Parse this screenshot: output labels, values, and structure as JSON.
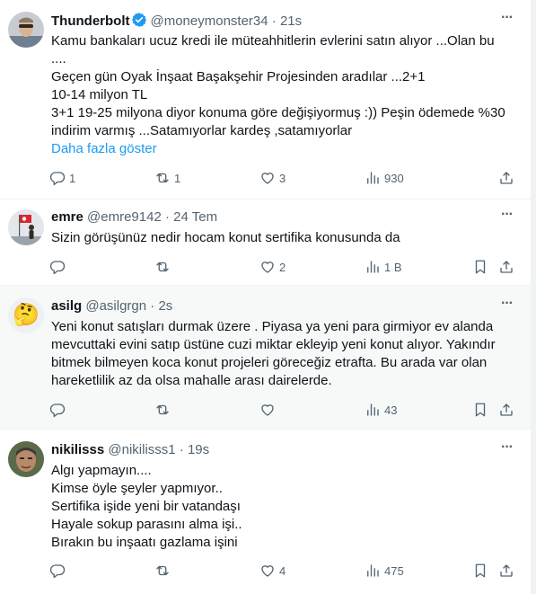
{
  "tweets": [
    {
      "name": "Thunderbolt",
      "handle": "@moneymonster34",
      "dot": "·",
      "time": "21s",
      "lines": [
        "Kamu bankaları ucuz kredi ile müteahhitlerin evlerini satın alıyor ...Olan bu",
        "....",
        "Geçen gün Oyak İnşaat Başakşehir Projesinden aradılar ...2+1",
        "10-14 milyon TL",
        "3+1 19-25 milyona diyor konuma göre değişiyormuş :)) Peşin ödemede %30",
        "indirim varmış ...Satamıyorlar kardeş ,satamıyorlar"
      ],
      "show_more": "Daha fazla göster",
      "replies": "1",
      "retweets": "1",
      "likes": "3",
      "views": "930"
    },
    {
      "name": "emre",
      "handle": "@emre9142",
      "dot": "·",
      "time": "24 Tem",
      "lines": [
        "Sizin görüşünüz nedir hocam konut sertifika konusunda da"
      ],
      "replies": "",
      "retweets": "",
      "likes": "2",
      "views": "1 B"
    },
    {
      "name": "asilg",
      "handle": "@asilgrgn",
      "dot": "·",
      "time": "2s",
      "lines": [
        "Yeni konut satışları durmak üzere . Piyasa ya yeni para girmiyor ev alanda",
        "mevcuttaki evini satıp üstüne cuzi miktar ekleyip yeni konut alıyor. Yakındır",
        "bitmek bilmeyen koca konut projeleri göreceğiz etrafta. Bu arada var olan",
        "hareketlilik az da olsa mahalle arası dairelerde."
      ],
      "replies": "",
      "retweets": "",
      "likes": "",
      "views": "43"
    },
    {
      "name": "nikilisss",
      "handle": "@nikilisss1",
      "dot": "·",
      "time": "19s",
      "lines": [
        "Algı yapmayın....",
        "Kimse öyle şeyler yapmıyor..",
        "Sertifika işide yeni bir vatandaşı",
        "Hayale sokup parasını alma işi..",
        "Bırakın bu inşaatı gazlama işini"
      ],
      "replies": "",
      "retweets": "",
      "likes": "4",
      "views": "475"
    }
  ],
  "avatar_emoji": "🤔",
  "colors": {
    "accent": "#1d9bf0",
    "muted": "#536471",
    "highlight_bg": "#f7f9f9"
  },
  "icons": [
    "verified-badge-icon",
    "more-icon",
    "reply-icon",
    "retweet-icon",
    "like-icon",
    "views-icon",
    "bookmark-icon",
    "share-icon"
  ]
}
